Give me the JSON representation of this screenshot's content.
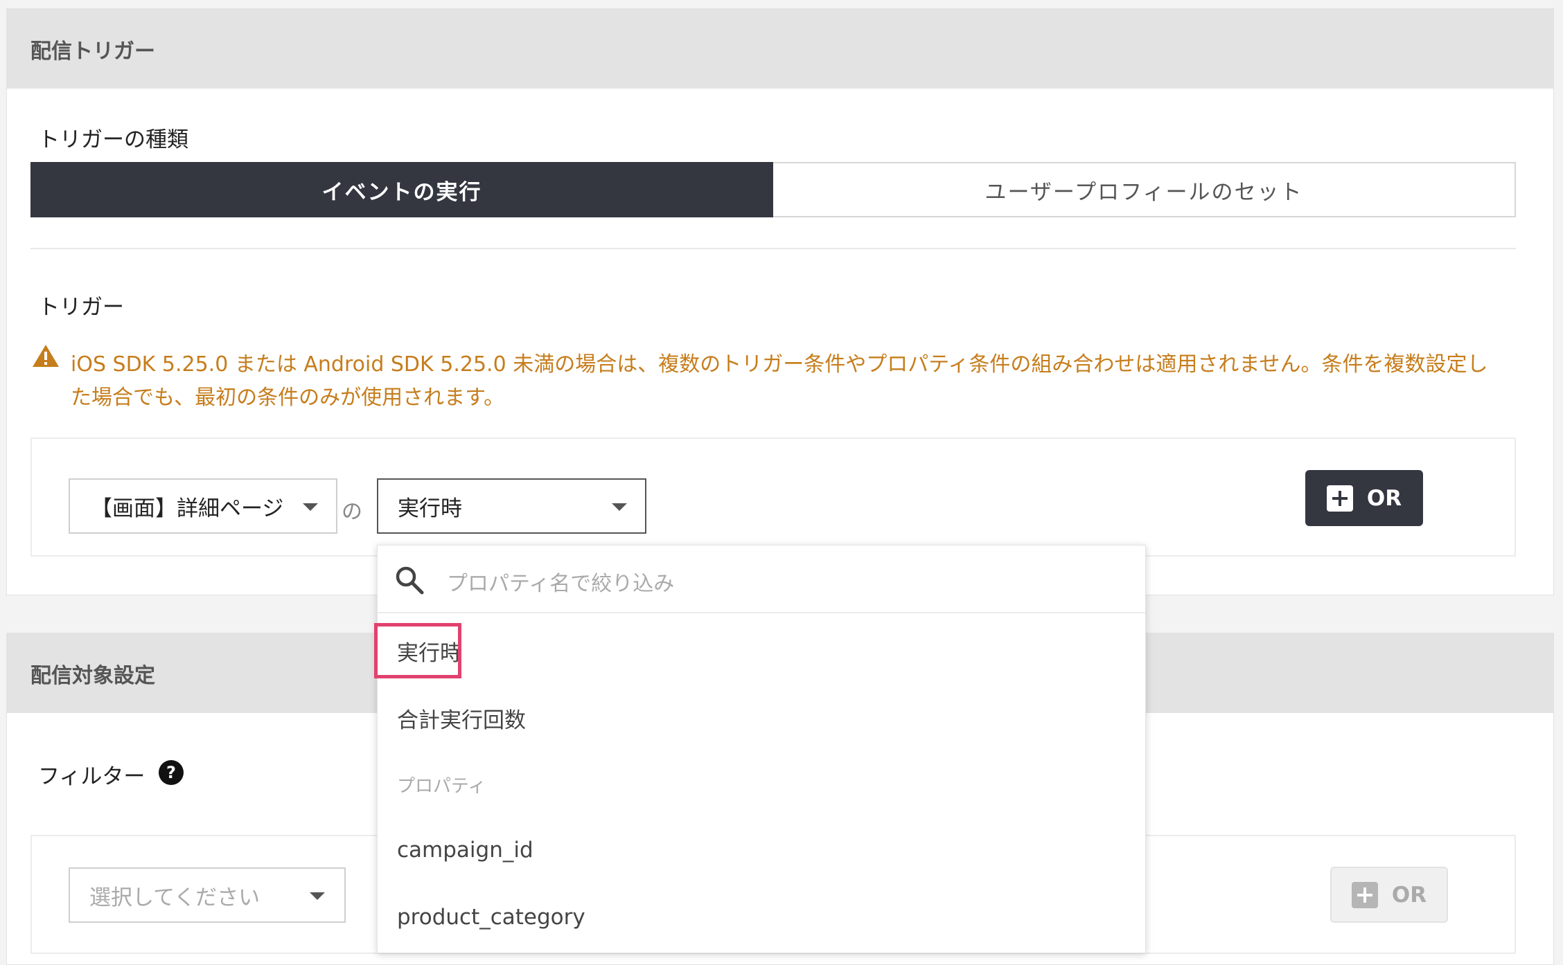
{
  "delivery_trigger": {
    "section_title": "配信トリガー",
    "trigger_type_label": "トリガーの種類",
    "tabs": [
      {
        "label": "イベントの実行",
        "active": true
      },
      {
        "label": "ユーザープロフィールのセット",
        "active": false
      }
    ],
    "trigger_label": "トリガー",
    "warning_line1": "iOS SDK 5.25.0 または Android SDK 5.25.0 未満の場合は、複数のトリガー条件やプロパティ条件の組み合わせは適用されません。条件を複数設定し",
    "warning_line2": "た場合でも、最初の条件のみが使用されます。",
    "event_select_value": "【画面】詳細ページ",
    "connector": "の",
    "timing_select_value": "実行時",
    "or_button_label": "OR"
  },
  "dropdown": {
    "search_placeholder": "プロパティ名で絞り込み",
    "items": [
      {
        "label": "実行時",
        "selected": true
      },
      {
        "label": "合計実行回数"
      }
    ],
    "group_header": "プロパティ",
    "property_items": [
      {
        "label": "campaign_id"
      },
      {
        "label": "product_category"
      }
    ]
  },
  "target_settings": {
    "section_title": "配信対象設定",
    "filter_label": "フィルター",
    "help_symbol": "?",
    "select_placeholder": "選択してください",
    "or_button_label": "OR"
  },
  "colors": {
    "accent_dark": "#343640",
    "warning": "#c67d1c",
    "highlight": "#e2416e"
  }
}
